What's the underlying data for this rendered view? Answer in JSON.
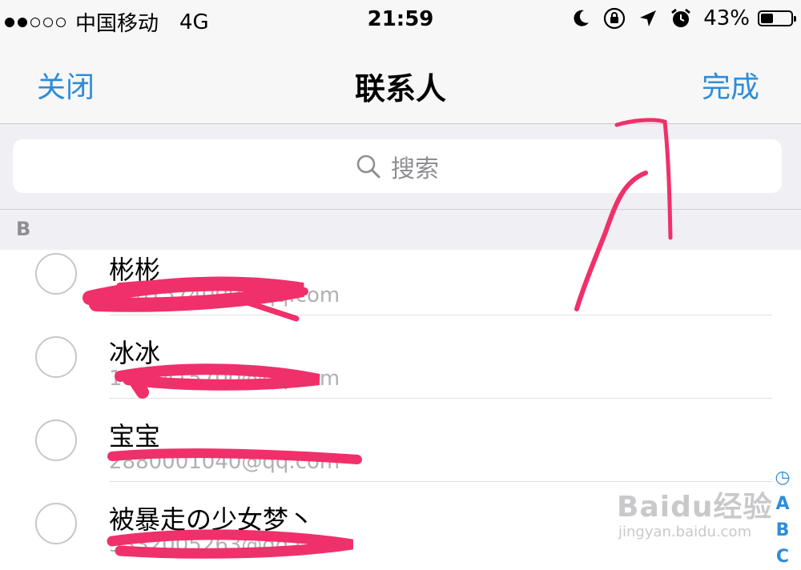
{
  "status_bar": {
    "carrier": "中国移动",
    "network": "4G",
    "time": "21:59",
    "battery": "43%",
    "battery_level": 0.43,
    "icons": [
      "signal-dots-icon",
      "moon-icon",
      "rotation-lock-icon",
      "location-arrow-icon",
      "alarm-icon",
      "battery-icon"
    ]
  },
  "nav": {
    "close_label": "关闭",
    "title": "联系人",
    "done_label": "完成"
  },
  "search": {
    "placeholder": "搜索"
  },
  "section": {
    "letter": "B"
  },
  "contacts": [
    {
      "name": "彬彬",
      "email": "2201574000@qq.com"
    },
    {
      "name": "冰冰",
      "email": "1050415700@qq.com"
    },
    {
      "name": "宝宝",
      "email": "2880001040@qq.com"
    },
    {
      "name": "被暴走の少女梦丶",
      "email": "3332005263@qq.com"
    }
  ],
  "index": [
    "◷",
    "A",
    "B",
    "C"
  ],
  "watermark": {
    "main": "Baidu经验",
    "sub": "jingyan.baidu.com"
  },
  "colors": {
    "accent": "#2f8cd9",
    "annotation": "#f0306a",
    "bar_bg": "#f7f7f8",
    "section_bg": "#efeff4"
  }
}
